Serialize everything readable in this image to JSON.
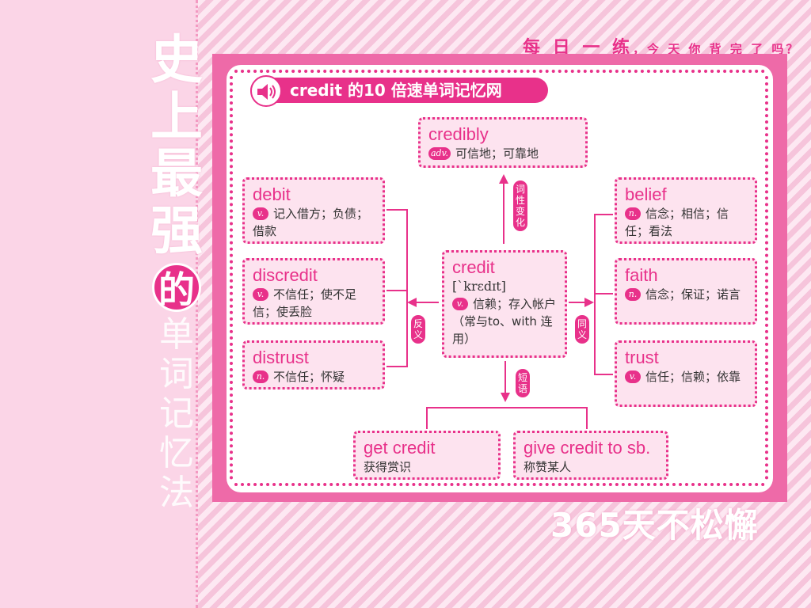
{
  "side_title": {
    "big": [
      "史",
      "上",
      "最",
      "强"
    ],
    "de": "的",
    "small": [
      "单",
      "词",
      "记",
      "忆",
      "法"
    ]
  },
  "slogan_top": {
    "main": "每 日 一 练",
    "sub": "，今 天 你 背 完 了 吗？"
  },
  "slogan_bottom": "365天不松懈",
  "header": {
    "title": "credit 的10 倍速单词记忆网",
    "icon": "speaker-icon"
  },
  "center": {
    "word": "credit",
    "phonetic": "[ˋkrɛdɪt]",
    "pos": "v.",
    "def": "信赖；存入帐户（常与to、with 连用）"
  },
  "top": {
    "word": "credibly",
    "pos": "adv.",
    "def": "可信地；可靠地"
  },
  "antonyms": [
    {
      "word": "debit",
      "pos": "v.",
      "def": "记入借方；负债；借款"
    },
    {
      "word": "discredit",
      "pos": "v.",
      "def": "不信任；使不足信；使丢脸"
    },
    {
      "word": "distrust",
      "pos": "n.",
      "def": "不信任；怀疑"
    }
  ],
  "synonyms": [
    {
      "word": "belief",
      "pos": "n.",
      "def": "信念；相信；信任；看法"
    },
    {
      "word": "faith",
      "pos": "n.",
      "def": "信念；保证；诺言"
    },
    {
      "word": "trust",
      "pos": "v.",
      "def": "信任；信赖；依靠"
    }
  ],
  "phrases": [
    {
      "word": "get credit",
      "def": "获得赏识"
    },
    {
      "word": "give credit to sb.",
      "def": "称赞某人"
    }
  ],
  "tags": {
    "derivation": "词性变化",
    "antonym": "反义",
    "synonym": "同义",
    "phrase": "短语"
  },
  "colors": {
    "accent": "#e8318a",
    "card": "#fde3ef",
    "frame": "#ee6aa8"
  }
}
